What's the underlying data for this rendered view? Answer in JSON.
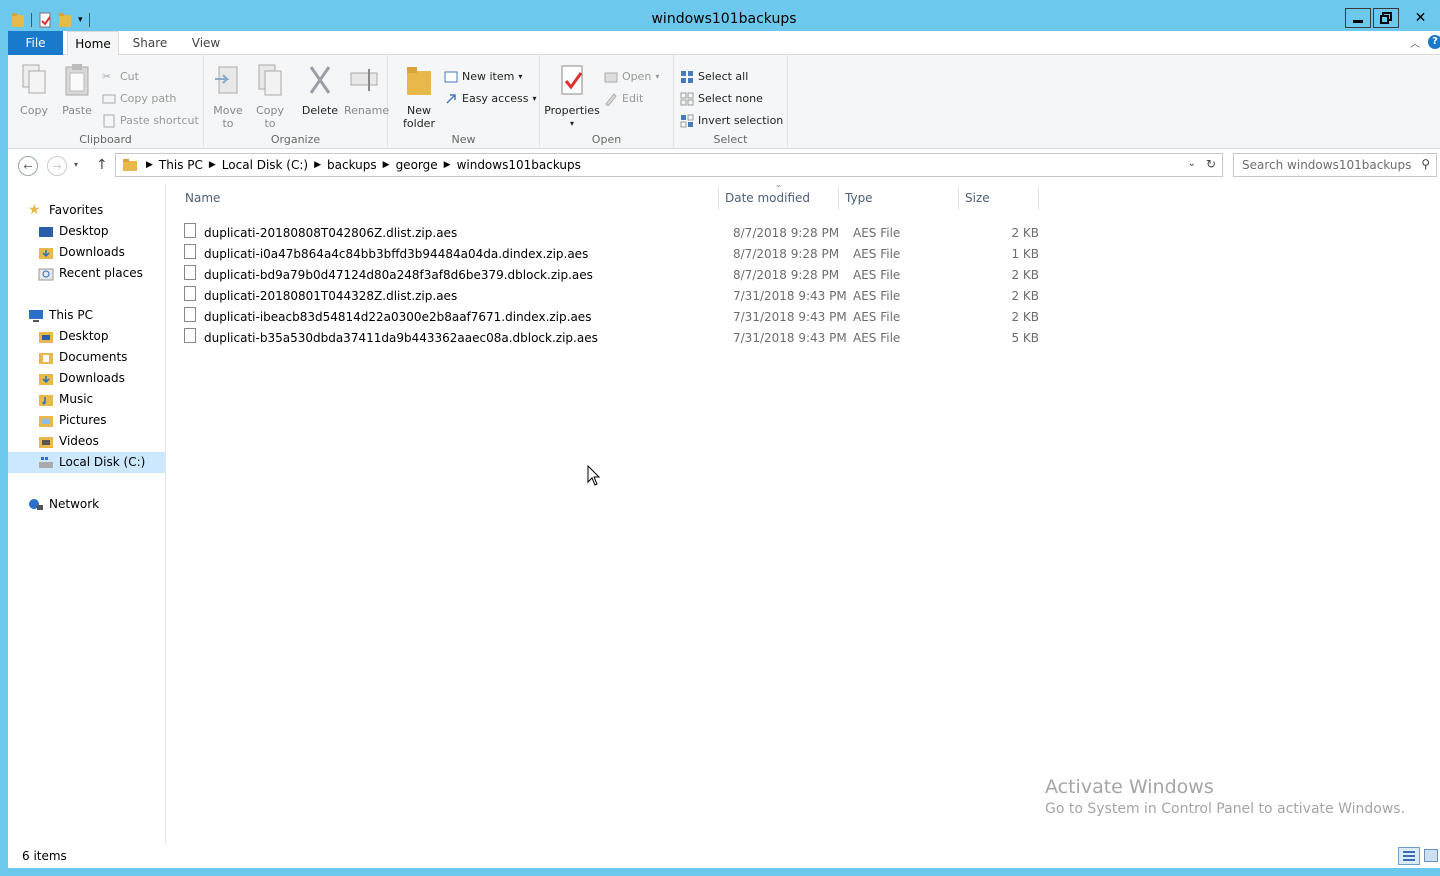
{
  "window": {
    "title": "windows101backups"
  },
  "ribbon_tabs": {
    "file": "File",
    "home": "Home",
    "share": "Share",
    "view": "View"
  },
  "ribbon": {
    "clipboard": {
      "label": "Clipboard",
      "copy": "Copy",
      "paste": "Paste",
      "cut": "Cut",
      "copy_path": "Copy path",
      "paste_shortcut": "Paste shortcut"
    },
    "organize": {
      "label": "Organize",
      "move_to_1": "Move",
      "move_to_2": "to",
      "copy_to_1": "Copy",
      "copy_to_2": "to",
      "delete": "Delete",
      "rename": "Rename"
    },
    "new": {
      "label": "New",
      "new_folder_1": "New",
      "new_folder_2": "folder",
      "new_item": "New item",
      "easy_access": "Easy access"
    },
    "open": {
      "label": "Open",
      "properties": "Properties",
      "open": "Open",
      "edit": "Edit"
    },
    "select": {
      "label": "Select",
      "select_all": "Select all",
      "select_none": "Select none",
      "invert_selection": "Invert selection"
    }
  },
  "address": {
    "crumbs": [
      "This PC",
      "Local Disk (C:)",
      "backups",
      "george",
      "windows101backups"
    ],
    "search_placeholder": "Search windows101backups"
  },
  "nav": {
    "favorites": "Favorites",
    "fav_items": [
      "Desktop",
      "Downloads",
      "Recent places"
    ],
    "this_pc": "This PC",
    "pc_items": [
      "Desktop",
      "Documents",
      "Downloads",
      "Music",
      "Pictures",
      "Videos",
      "Local Disk (C:)"
    ],
    "network": "Network"
  },
  "columns": {
    "name": "Name",
    "date": "Date modified",
    "type": "Type",
    "size": "Size"
  },
  "files": [
    {
      "name": "duplicati-20180808T042806Z.dlist.zip.aes",
      "date": "8/7/2018 9:28 PM",
      "type": "AES File",
      "size": "2 KB"
    },
    {
      "name": "duplicati-i0a47b864a4c84bb3bffd3b94484a04da.dindex.zip.aes",
      "date": "8/7/2018 9:28 PM",
      "type": "AES File",
      "size": "1 KB"
    },
    {
      "name": "duplicati-bd9a79b0d47124d80a248f3af8d6be379.dblock.zip.aes",
      "date": "8/7/2018 9:28 PM",
      "type": "AES File",
      "size": "2 KB"
    },
    {
      "name": "duplicati-20180801T044328Z.dlist.zip.aes",
      "date": "7/31/2018 9:43 PM",
      "type": "AES File",
      "size": "2 KB"
    },
    {
      "name": "duplicati-ibeacb83d54814d22a0300e2b8aaf7671.dindex.zip.aes",
      "date": "7/31/2018 9:43 PM",
      "type": "AES File",
      "size": "2 KB"
    },
    {
      "name": "duplicati-b35a530dbda37411da9b443362aaec08a.dblock.zip.aes",
      "date": "7/31/2018 9:43 PM",
      "type": "AES File",
      "size": "5 KB"
    }
  ],
  "status": {
    "count": "6 items"
  },
  "watermark": {
    "line1": "Activate Windows",
    "line2": "Go to System in Control Panel to activate Windows."
  },
  "colors": {
    "titlebar": "#6cc8ec",
    "file_tab": "#1979ca",
    "selection": "#cce8ff",
    "folder": "#e8b84a"
  }
}
